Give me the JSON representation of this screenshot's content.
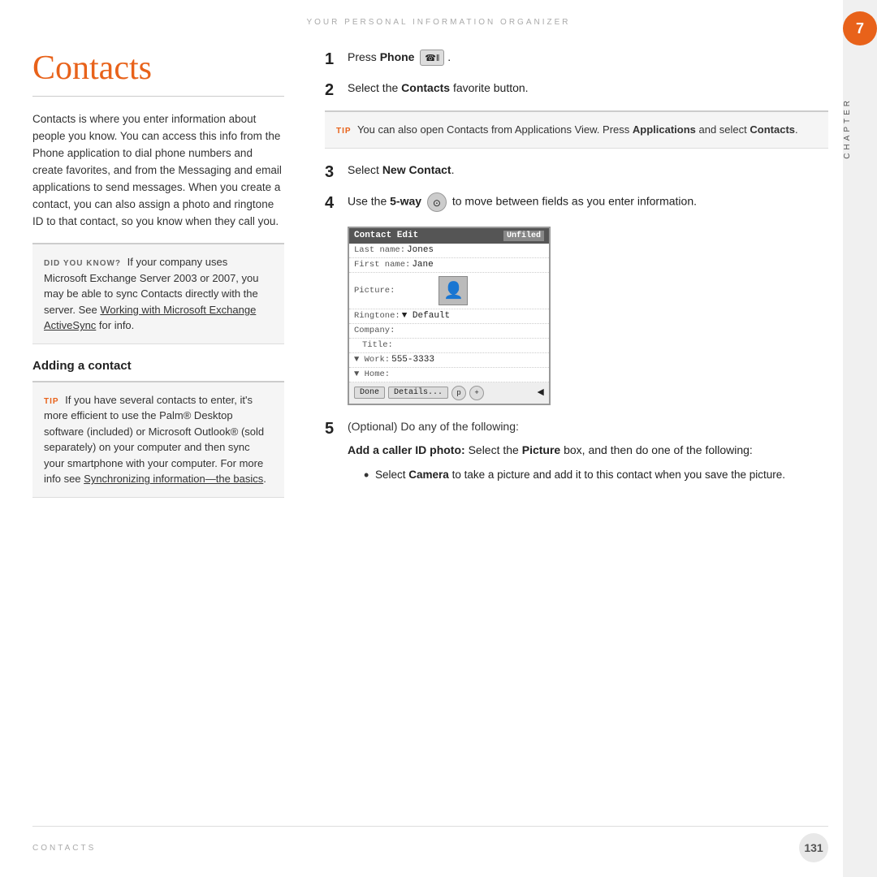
{
  "page": {
    "header": "YOUR PERSONAL INFORMATION ORGANIZER",
    "chapter_number": "7",
    "chapter_label": "CHAPTER"
  },
  "left": {
    "title": "Contacts",
    "body": "Contacts is where you enter information about people you know. You can access this info from the Phone application to dial phone numbers and create favorites, and from the Messaging and email applications to send messages. When you create a contact, you can also assign a photo and ringtone ID to that contact, so you know when they call you.",
    "did_you_know_label": "DID YOU KNOW?",
    "did_you_know_text": " If your company uses Microsoft Exchange Server 2003 or 2007, you may be able to sync Contacts directly with the server. See ",
    "did_you_know_link": "Working with Microsoft Exchange ActiveSync",
    "did_you_know_suffix": " for info.",
    "section_heading": "Adding a contact",
    "tip_label": "TIP",
    "tip_text": " If you have several contacts to enter, it's more efficient to use the Palm® Desktop software (included) or Microsoft Outlook® (sold separately) on your computer and then sync your smartphone with your computer. For more info see ",
    "tip_link": "Synchronizing information—the basics",
    "tip_suffix": "."
  },
  "right": {
    "step1_number": "1",
    "step1_text": "Press ",
    "step1_bold": "Phone",
    "step2_number": "2",
    "step2_text": "Select the ",
    "step2_bold": "Contacts",
    "step2_suffix": " favorite button.",
    "tip_label": "TIP",
    "tip_text": " You can also open Contacts from Applications View. Press ",
    "tip_bold1": "Applications",
    "tip_text2": " and select ",
    "tip_bold2": "Contacts",
    "tip_suffix": ".",
    "step3_number": "3",
    "step3_text": "Select ",
    "step3_bold": "New Contact",
    "step3_suffix": ".",
    "step4_number": "4",
    "step4_text": "Use the ",
    "step4_bold": "5-way",
    "step4_suffix": " to move between fields as you enter information.",
    "contact_edit": {
      "title": "Contact Edit",
      "unfiled": "Unfiled",
      "row1_label": "Last name:",
      "row1_value": "Jones",
      "row2_label": "First name:",
      "row2_value": "Jane",
      "row3_label": "Picture:",
      "row4_label": "Ringtone:",
      "row4_value": "▼ Default",
      "row5_label": "Company:",
      "row6_label": "Title:",
      "row7_label": "▼ Work:",
      "row7_value": "555-3333",
      "row8_label": "▼ Home:",
      "btn_done": "Done",
      "btn_details": "Details...",
      "arrow": "◄"
    },
    "step5_number": "5",
    "step5_optional": "(Optional)  Do any of the following:",
    "step5_bold_intro": "Add a caller ID photo:",
    "step5_text": " Select the ",
    "step5_bold2": "Picture",
    "step5_suffix": " box, and then do one of the following:",
    "bullet1_bold": "Camera",
    "bullet1_text": " to take a picture and add it to this contact when you save the picture.",
    "bullet1_prefix": "Select "
  },
  "footer": {
    "left_text": "CONTACTS",
    "page_number": "131"
  }
}
